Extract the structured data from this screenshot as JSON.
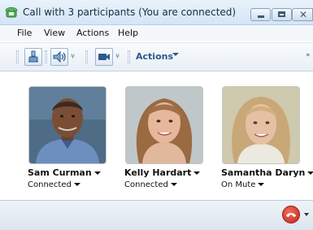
{
  "window": {
    "title": "Call with 3 participants (You are connected)",
    "controls": {
      "minimize": "minimize",
      "maximize": "maximize",
      "close": "✕"
    }
  },
  "menu": {
    "items": [
      "File",
      "View",
      "Actions",
      "Help"
    ]
  },
  "toolbar": {
    "actions_label": "Actions",
    "overflow_glyph": "»"
  },
  "participants": [
    {
      "name": "Sam Curman",
      "status": "Connected",
      "skin": "#7a4e35",
      "bg": "#4e6c86",
      "shirt": "#6d8fc0"
    },
    {
      "name": "Kelly Hardart",
      "status": "Connected",
      "skin": "#e7b79b",
      "bg": "#bfc7c9",
      "shirt": "#d9c3a8"
    },
    {
      "name": "Samantha Daryn",
      "status": "On Mute",
      "skin": "#e6c0a3",
      "bg": "#cfc9ad",
      "shirt": "#ece9e0"
    }
  ],
  "colors": {
    "accent": "#2c5a8c",
    "hangup": "#d7372a"
  }
}
